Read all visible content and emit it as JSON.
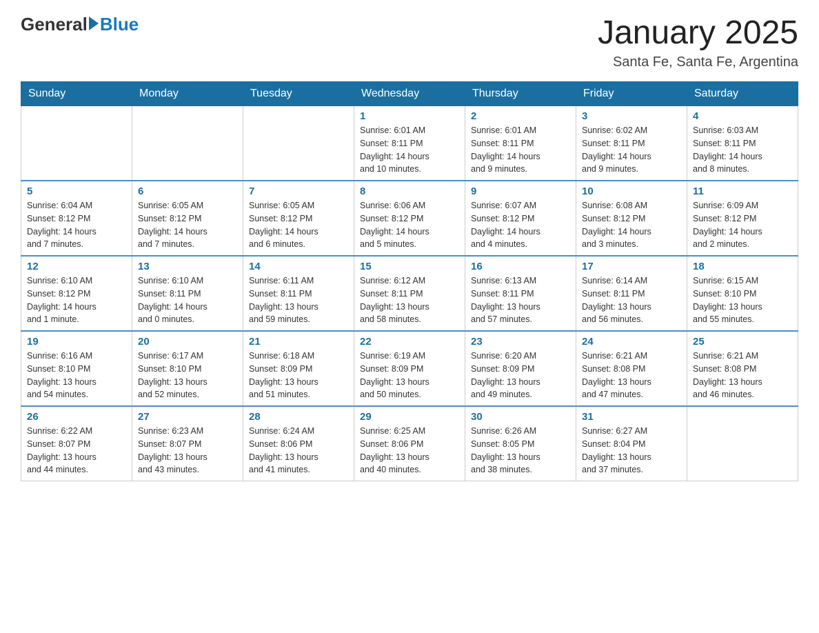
{
  "header": {
    "logo_general": "General",
    "logo_blue": "Blue",
    "month_title": "January 2025",
    "location": "Santa Fe, Santa Fe, Argentina"
  },
  "days_of_week": [
    "Sunday",
    "Monday",
    "Tuesday",
    "Wednesday",
    "Thursday",
    "Friday",
    "Saturday"
  ],
  "weeks": [
    [
      {
        "day": "",
        "info": ""
      },
      {
        "day": "",
        "info": ""
      },
      {
        "day": "",
        "info": ""
      },
      {
        "day": "1",
        "info": "Sunrise: 6:01 AM\nSunset: 8:11 PM\nDaylight: 14 hours\nand 10 minutes."
      },
      {
        "day": "2",
        "info": "Sunrise: 6:01 AM\nSunset: 8:11 PM\nDaylight: 14 hours\nand 9 minutes."
      },
      {
        "day": "3",
        "info": "Sunrise: 6:02 AM\nSunset: 8:11 PM\nDaylight: 14 hours\nand 9 minutes."
      },
      {
        "day": "4",
        "info": "Sunrise: 6:03 AM\nSunset: 8:11 PM\nDaylight: 14 hours\nand 8 minutes."
      }
    ],
    [
      {
        "day": "5",
        "info": "Sunrise: 6:04 AM\nSunset: 8:12 PM\nDaylight: 14 hours\nand 7 minutes."
      },
      {
        "day": "6",
        "info": "Sunrise: 6:05 AM\nSunset: 8:12 PM\nDaylight: 14 hours\nand 7 minutes."
      },
      {
        "day": "7",
        "info": "Sunrise: 6:05 AM\nSunset: 8:12 PM\nDaylight: 14 hours\nand 6 minutes."
      },
      {
        "day": "8",
        "info": "Sunrise: 6:06 AM\nSunset: 8:12 PM\nDaylight: 14 hours\nand 5 minutes."
      },
      {
        "day": "9",
        "info": "Sunrise: 6:07 AM\nSunset: 8:12 PM\nDaylight: 14 hours\nand 4 minutes."
      },
      {
        "day": "10",
        "info": "Sunrise: 6:08 AM\nSunset: 8:12 PM\nDaylight: 14 hours\nand 3 minutes."
      },
      {
        "day": "11",
        "info": "Sunrise: 6:09 AM\nSunset: 8:12 PM\nDaylight: 14 hours\nand 2 minutes."
      }
    ],
    [
      {
        "day": "12",
        "info": "Sunrise: 6:10 AM\nSunset: 8:12 PM\nDaylight: 14 hours\nand 1 minute."
      },
      {
        "day": "13",
        "info": "Sunrise: 6:10 AM\nSunset: 8:11 PM\nDaylight: 14 hours\nand 0 minutes."
      },
      {
        "day": "14",
        "info": "Sunrise: 6:11 AM\nSunset: 8:11 PM\nDaylight: 13 hours\nand 59 minutes."
      },
      {
        "day": "15",
        "info": "Sunrise: 6:12 AM\nSunset: 8:11 PM\nDaylight: 13 hours\nand 58 minutes."
      },
      {
        "day": "16",
        "info": "Sunrise: 6:13 AM\nSunset: 8:11 PM\nDaylight: 13 hours\nand 57 minutes."
      },
      {
        "day": "17",
        "info": "Sunrise: 6:14 AM\nSunset: 8:11 PM\nDaylight: 13 hours\nand 56 minutes."
      },
      {
        "day": "18",
        "info": "Sunrise: 6:15 AM\nSunset: 8:10 PM\nDaylight: 13 hours\nand 55 minutes."
      }
    ],
    [
      {
        "day": "19",
        "info": "Sunrise: 6:16 AM\nSunset: 8:10 PM\nDaylight: 13 hours\nand 54 minutes."
      },
      {
        "day": "20",
        "info": "Sunrise: 6:17 AM\nSunset: 8:10 PM\nDaylight: 13 hours\nand 52 minutes."
      },
      {
        "day": "21",
        "info": "Sunrise: 6:18 AM\nSunset: 8:09 PM\nDaylight: 13 hours\nand 51 minutes."
      },
      {
        "day": "22",
        "info": "Sunrise: 6:19 AM\nSunset: 8:09 PM\nDaylight: 13 hours\nand 50 minutes."
      },
      {
        "day": "23",
        "info": "Sunrise: 6:20 AM\nSunset: 8:09 PM\nDaylight: 13 hours\nand 49 minutes."
      },
      {
        "day": "24",
        "info": "Sunrise: 6:21 AM\nSunset: 8:08 PM\nDaylight: 13 hours\nand 47 minutes."
      },
      {
        "day": "25",
        "info": "Sunrise: 6:21 AM\nSunset: 8:08 PM\nDaylight: 13 hours\nand 46 minutes."
      }
    ],
    [
      {
        "day": "26",
        "info": "Sunrise: 6:22 AM\nSunset: 8:07 PM\nDaylight: 13 hours\nand 44 minutes."
      },
      {
        "day": "27",
        "info": "Sunrise: 6:23 AM\nSunset: 8:07 PM\nDaylight: 13 hours\nand 43 minutes."
      },
      {
        "day": "28",
        "info": "Sunrise: 6:24 AM\nSunset: 8:06 PM\nDaylight: 13 hours\nand 41 minutes."
      },
      {
        "day": "29",
        "info": "Sunrise: 6:25 AM\nSunset: 8:06 PM\nDaylight: 13 hours\nand 40 minutes."
      },
      {
        "day": "30",
        "info": "Sunrise: 6:26 AM\nSunset: 8:05 PM\nDaylight: 13 hours\nand 38 minutes."
      },
      {
        "day": "31",
        "info": "Sunrise: 6:27 AM\nSunset: 8:04 PM\nDaylight: 13 hours\nand 37 minutes."
      },
      {
        "day": "",
        "info": ""
      }
    ]
  ]
}
